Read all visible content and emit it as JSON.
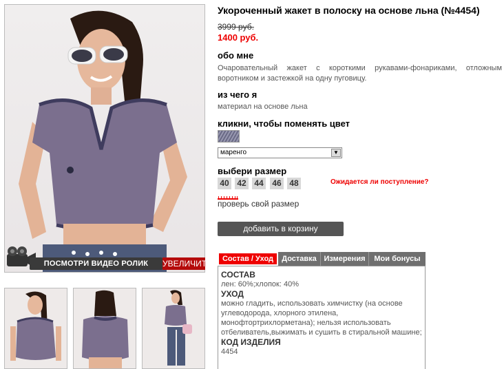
{
  "product": {
    "title": "Укороченный жакет в полоску на основе льна (№4454)",
    "old_price": "3999 руб.",
    "new_price": "1400 руб."
  },
  "about": {
    "heading": "обо мне",
    "text": "Очаровательный жакет с короткими рукавами-фонариками, отложным воротником и застежкой на одну пуговицу."
  },
  "material": {
    "heading": "из чего я",
    "text": "материал на основе льна"
  },
  "color": {
    "heading": "кликни, чтобы поменять цвет",
    "selected": "маренго"
  },
  "size": {
    "heading": "выбери размер",
    "options": [
      "40",
      "42",
      "44",
      "46",
      "48"
    ],
    "availability_link": "Ожидается ли поступление?",
    "check_size_link": "проверь свой размер"
  },
  "cart": {
    "button_label": "добавить в корзину"
  },
  "media": {
    "video_button": "ПОСМОТРИ ВИДЕО РОЛИК",
    "zoom_button": "УВЕЛИЧИТЬ"
  },
  "tabs": [
    {
      "label": "Состав / Уход",
      "active": true
    },
    {
      "label": "Доставка",
      "active": false
    },
    {
      "label": "Измерения",
      "active": false
    },
    {
      "label": "Мои бонусы",
      "active": false
    }
  ],
  "tab_content": {
    "composition_h": "СОСТАВ",
    "composition": "лен: 60%;хлопок: 40%",
    "care_h": "УХОД",
    "care": "можно гладить, использовать химчистку (на основе углеводорода, хлорного этилена, монофтортрихлорметана); нельзя использовать отбеливатель,выжимать и сушить в стиральной машине;",
    "code_h": "КОД ИЗДЕЛИЯ",
    "code": "4454"
  },
  "colors": {
    "accent_red": "#e00000",
    "tab_grey": "#6f6f6f",
    "button_grey": "#555555"
  }
}
